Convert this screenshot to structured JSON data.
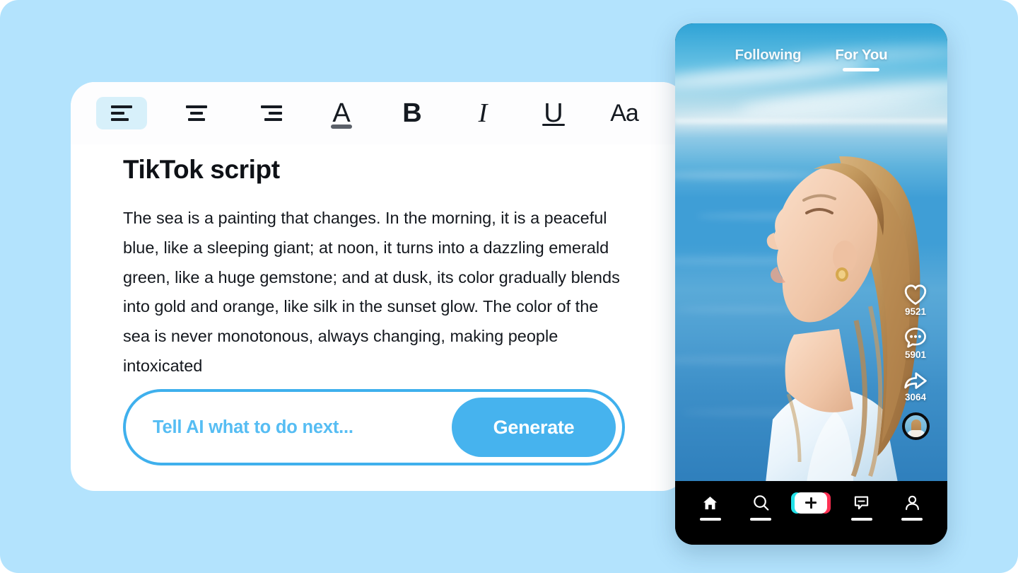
{
  "theme": {
    "page_background": "#b3e3fd",
    "accent_blue": "#46b3ee",
    "accent_border": "#3fb0ed",
    "placeholder_blue": "#56bdf3",
    "toolbar_active_bg": "#d7f0fa",
    "text_dark": "#14181e",
    "nav_background": "#000000"
  },
  "editor": {
    "toolbar": {
      "items": [
        {
          "id": "align-left",
          "icon": "align-left-icon",
          "label": "Align left",
          "active": true
        },
        {
          "id": "align-center",
          "icon": "align-center-icon",
          "label": "Align center",
          "active": false
        },
        {
          "id": "align-right",
          "icon": "align-right-icon",
          "label": "Align right",
          "active": false
        },
        {
          "id": "text-color",
          "icon": "text-color-icon",
          "label": "A",
          "active": false
        },
        {
          "id": "bold",
          "icon": "bold-icon",
          "label": "B",
          "active": false
        },
        {
          "id": "italic",
          "icon": "italic-icon",
          "label": "I",
          "active": false
        },
        {
          "id": "underline",
          "icon": "underline-icon",
          "label": "U",
          "active": false
        },
        {
          "id": "font-size",
          "icon": "font-size-icon",
          "label": "Aa",
          "active": false
        }
      ]
    },
    "document": {
      "title": "TikTok script",
      "body": "The sea is a painting that changes. In the morning, it is a peaceful blue, like a sleeping giant; at noon, it turns into a dazzling emerald green, like a huge gemstone; and at dusk, its color gradually blends into gold and orange, like silk in the sunset glow. The color of the sea is never monotonous, always changing, making people intoxicated"
    },
    "prompt_bar": {
      "input_value": "",
      "input_placeholder": "Tell AI what to do next...",
      "generate_label": "Generate"
    }
  },
  "phone": {
    "tabs": [
      {
        "id": "following",
        "label": "Following",
        "active": false
      },
      {
        "id": "for-you",
        "label": "For You",
        "active": true
      }
    ],
    "video": {
      "description": "Woman with long blonde hair facing upward toward the sky, blue ocean and clouds in the background"
    },
    "actions": [
      {
        "id": "like",
        "icon": "heart-icon",
        "count": "9521"
      },
      {
        "id": "comment",
        "icon": "comment-icon",
        "count": "5901"
      },
      {
        "id": "share",
        "icon": "share-arrow-icon",
        "count": "3064"
      }
    ],
    "avatar": {
      "id": "profile-avatar",
      "label": "Creator avatar"
    },
    "nav": [
      {
        "id": "home",
        "icon": "home-icon",
        "label": "Home",
        "underline": true
      },
      {
        "id": "discover",
        "icon": "search-icon",
        "label": "Discover",
        "underline": true
      },
      {
        "id": "create",
        "icon": "plus-icon",
        "label": "Create",
        "underline": false
      },
      {
        "id": "inbox",
        "icon": "inbox-icon",
        "label": "Inbox",
        "underline": true
      },
      {
        "id": "profile",
        "icon": "person-icon",
        "label": "Profile",
        "underline": true
      }
    ]
  }
}
